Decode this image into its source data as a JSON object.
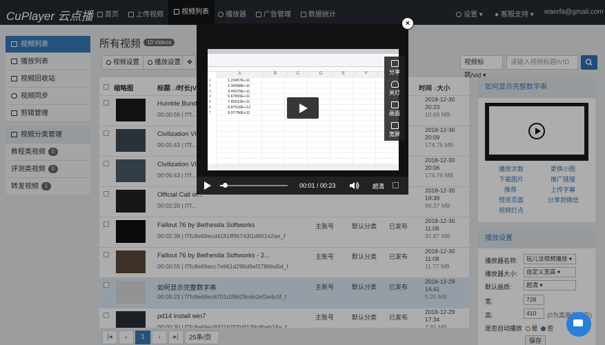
{
  "brand": "CuPlayer 云点播",
  "nav": {
    "items": [
      "首页",
      "上传视频",
      "视频列表",
      "播放器",
      "广告管理",
      "数据统计"
    ],
    "active": 2,
    "settings": "设置",
    "support": "客服支持",
    "user": "waerfa@gmail.com"
  },
  "sidebar": {
    "items": [
      {
        "label": "视频列表",
        "active": true
      },
      {
        "label": "播放列表"
      },
      {
        "label": "视频回收站"
      },
      {
        "label": "视频同步"
      },
      {
        "label": "剪辑管理"
      }
    ],
    "category_header": "视频分类管理",
    "categories": [
      {
        "label": "教程类视频",
        "count": "0"
      },
      {
        "label": "评测类视频",
        "count": "0"
      },
      {
        "label": "转发视频",
        "count": "1"
      }
    ]
  },
  "page": {
    "title": "所有视频",
    "count_badge": "10 Videos"
  },
  "toolbar": {
    "video_settings": "视频设置",
    "player_settings": "播放设置",
    "search_field": "视频标题/vid",
    "search_placeholder": "请输入视频标题/VID"
  },
  "table": {
    "headers": {
      "thumb": "缩略图",
      "title": "标题",
      "duration": "/时长|V",
      "time": "时间",
      "size": "大小"
    },
    "rows": [
      {
        "title": "Humble Bund...",
        "sub": "00:00:56 | f7f...",
        "owner": "",
        "category": "",
        "status": "",
        "date": "2018-12-30",
        "time": "20:23",
        "size": "10.69 MB"
      },
      {
        "title": "Civilization VI-...",
        "sub": "00:05:43 | f7f...",
        "owner": "",
        "category": "",
        "status": "",
        "date": "2018-12-30",
        "time": "20:09",
        "size": "174.76 MB"
      },
      {
        "title": "Civilization VI-...",
        "sub": "00:05:43 | f7f...",
        "owner": "",
        "category": "",
        "status": "",
        "date": "2018-12-30",
        "time": "20:06",
        "size": "174.76 MB"
      },
      {
        "title": "Official Call of...",
        "sub": "00:02:20 | f7f...",
        "owner": "",
        "category": "",
        "status": "",
        "date": "2018-12-30",
        "time": "19:39",
        "size": "96.37 MB"
      },
      {
        "title": "Fallout 76 by Bethesda Softworks",
        "sub": "00:02:38 | f7fc8e69ecd4181ff96743f1d661e2ae_f",
        "owner": "主账号",
        "category": "默认分类",
        "status": "已发布",
        "date": "2018-12-30",
        "time": "11:08",
        "size": "31.87 MB"
      },
      {
        "title": "Fallout 76 by Bethesda Softworks - 2...",
        "sub": "00:00:55 | f7fc8e69ecc7e661d296d6ef2786ba5d_f",
        "owner": "主账号",
        "category": "默认分类",
        "status": "已发布",
        "date": "2018-12-30",
        "time": "11:08",
        "size": "11.77 MB"
      },
      {
        "title": "如何显示完整数字串",
        "sub": "00:00:23 | f7fc8e69ec8701d39629ceb2ef2e4c5f_f",
        "owner": "主账号",
        "category": "默认分类",
        "status": "已发布",
        "date": "2018-12-29",
        "time": "14:41",
        "size": "5.25 MB"
      },
      {
        "title": "pd14 install win7",
        "sub": "00:00:30 | f7fc8e69ec932167f704f139c9beb16a_f",
        "owner": "主账号",
        "category": "默认分类",
        "status": "已发布",
        "date": "2018-12-29",
        "time": "17:34",
        "size": "7.65 MB"
      }
    ]
  },
  "pager": {
    "current": "1",
    "page_size": "25条/页"
  },
  "right_panel": {
    "title": "如何显示完整数字串",
    "links": [
      "播放次数",
      "更换小图",
      "下载图片",
      "推广链接",
      "推荐",
      "上传字幕",
      "预览页面",
      "分享到微信",
      "视频打点"
    ]
  },
  "settings_panel": {
    "title": "播放设置",
    "player_name_label": "播放器名称:",
    "player_name": "玩儿法视频播放",
    "size_label": "播放器大小:",
    "size": "自定义宽高",
    "quality_label": "默认画质:",
    "quality": "超清",
    "width_label": "宽:",
    "width": "728",
    "height_label": "高:",
    "height": "410",
    "height_note": "(0为高度自适应)",
    "autoplay_label": "是否自动播放",
    "yes": "是",
    "no": "否",
    "save": "保存"
  },
  "modal": {
    "close": "×",
    "share_items": [
      "分享",
      "关灯",
      "画面",
      "宽屏"
    ],
    "time": "00:01 / 00:23",
    "hd": "超清",
    "progress_pct": 8,
    "excel": {
      "col_a": "A",
      "cols": [
        "B",
        "C",
        "D",
        "E",
        "F",
        "G"
      ],
      "values": [
        "1.23457E+11",
        "2.34568E+11",
        "3.45679E+11",
        "5.67891E+11",
        "7.89012E+11",
        "9.87615E+12",
        "9.97756E+11"
      ]
    }
  }
}
